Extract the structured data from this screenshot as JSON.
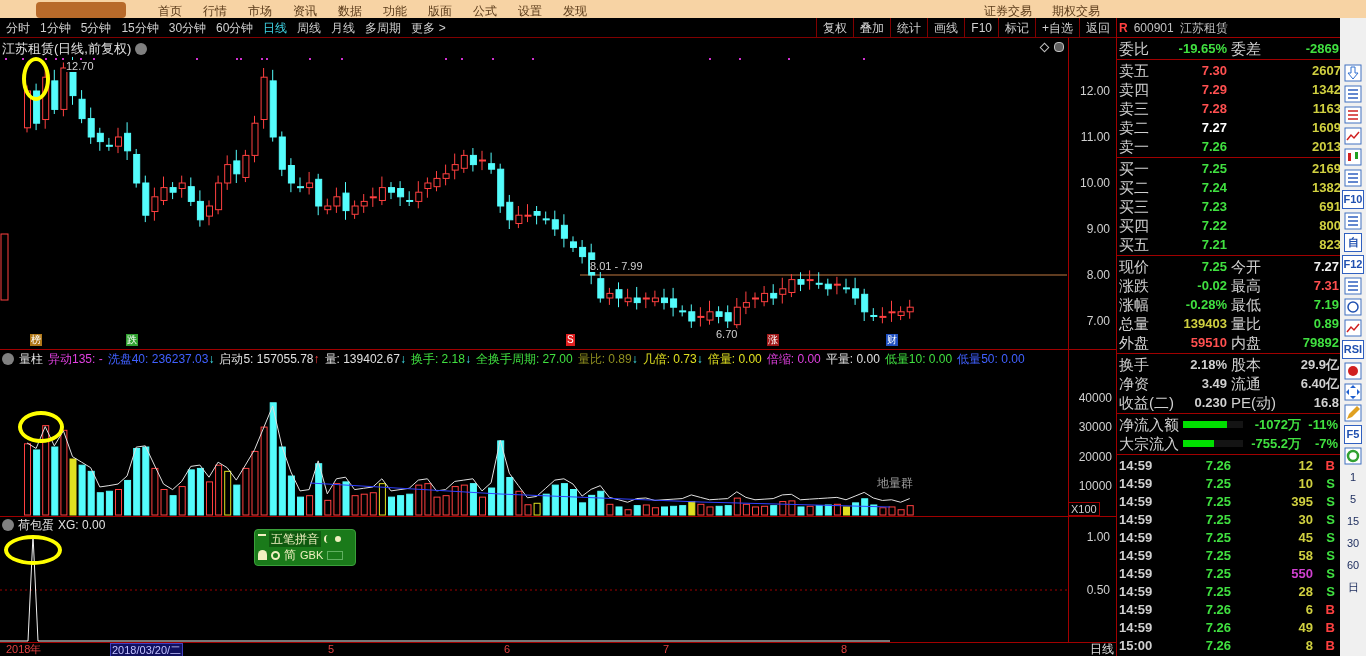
{
  "top_menu": {
    "items": [
      "首页",
      "行情",
      "市场",
      "资讯",
      "数据",
      "功能",
      "版面",
      "公式",
      "设置",
      "发现"
    ],
    "right_items": [
      "证券交易",
      "期权交易"
    ]
  },
  "period_tabs": [
    {
      "label": "分时",
      "selected": false
    },
    {
      "label": "1分钟",
      "selected": false
    },
    {
      "label": "5分钟",
      "selected": false
    },
    {
      "label": "15分钟",
      "selected": false
    },
    {
      "label": "30分钟",
      "selected": false
    },
    {
      "label": "60分钟",
      "selected": false
    },
    {
      "label": "日线",
      "selected": true
    },
    {
      "label": "周线",
      "selected": false
    },
    {
      "label": "月线",
      "selected": false
    },
    {
      "label": "多周期",
      "selected": false
    },
    {
      "label": "更多 >",
      "selected": false
    }
  ],
  "chart_buttons": [
    "复权",
    "叠加",
    "统计",
    "画线",
    "F10",
    "标记",
    "+自选",
    "返回"
  ],
  "price_panel": {
    "title": "江苏租赁(日线,前复权)",
    "y_ticks": [
      "12.00",
      "11.00",
      "10.00",
      "9.00",
      "8.00",
      "7.00"
    ],
    "annotations": [
      "12.70",
      "8.01 - 7.99",
      "6.70"
    ],
    "markers": [
      {
        "label": "榜",
        "color": "#b07818"
      },
      {
        "label": "跌",
        "color": "#30a030"
      },
      {
        "label": "S",
        "color": "#e02020"
      },
      {
        "label": "涨",
        "color": "#a01818"
      },
      {
        "label": "财",
        "color": "#2050c0"
      }
    ]
  },
  "volume_panel": {
    "name": "量柱",
    "indicators": [
      {
        "text": "异动135: -",
        "color": "#e040e0"
      },
      {
        "text": "洗盘40: 236237.03",
        "color": "#4060ff",
        "arrow": "↓",
        "rising": false
      },
      {
        "text": "启动5: 157055.78",
        "color": "#e0e0e0",
        "arrow": "↑",
        "rising": true
      },
      {
        "text": "量: 139402.67",
        "color": "#e0e0e0",
        "arrow": "↓",
        "rising": false
      },
      {
        "text": "换手: 2.18",
        "color": "#40e040",
        "arrow": "↓",
        "rising": false
      },
      {
        "text": "全换手周期: 27.00",
        "color": "#40e040"
      },
      {
        "text": "量比: 0.89",
        "color": "#909020",
        "arrow": "↓",
        "rising": false
      },
      {
        "text": "几倍: 0.73",
        "color": "#e0e020",
        "arrow": "↓",
        "rising": false
      },
      {
        "text": "倍量: 0.00",
        "color": "#e0e020"
      },
      {
        "text": "倍缩: 0.00",
        "color": "#e040e0"
      },
      {
        "text": "平量: 0.00",
        "color": "#e0e0e0"
      },
      {
        "text": "低量10: 0.00",
        "color": "#40e040"
      },
      {
        "text": "低量50: 0.00",
        "color": "#4060ff"
      }
    ],
    "y_ticks": [
      "40000",
      "30000",
      "20000",
      "10000"
    ],
    "unit": "X100",
    "note": "地量群"
  },
  "signal_panel": {
    "name": "荷包蛋",
    "indicator": "XG: 0.00",
    "y_ticks": [
      "1.00",
      "0.50"
    ]
  },
  "ime_toolbar": {
    "mode": "五笔拼音",
    "charset": "简",
    "encoding": "GBK"
  },
  "date_axis": {
    "labels": [
      {
        "label": "2018年",
        "selected": false
      },
      {
        "label": "2018/03/20/二",
        "selected": true
      },
      {
        "label": "5",
        "selected": false
      },
      {
        "label": "6",
        "selected": false
      },
      {
        "label": "7",
        "selected": false
      },
      {
        "label": "8",
        "selected": false
      }
    ],
    "period": "日线"
  },
  "quote_panel": {
    "flag": "R",
    "code": "600901",
    "name": "江苏租赁",
    "ratio": {
      "label": "委比",
      "value": "-19.65%",
      "label2": "委差",
      "value2": "-2869"
    },
    "asks": [
      {
        "label": "卖五",
        "price": "7.30",
        "volume": "2607",
        "color": "#ff5050"
      },
      {
        "label": "卖四",
        "price": "7.29",
        "volume": "1342",
        "color": "#ff5050"
      },
      {
        "label": "卖三",
        "price": "7.28",
        "volume": "1163",
        "color": "#ff5050"
      },
      {
        "label": "卖二",
        "price": "7.27",
        "volume": "1609",
        "color": "#ffffff"
      },
      {
        "label": "卖一",
        "price": "7.26",
        "volume": "2013",
        "color": "#40e040"
      }
    ],
    "bids": [
      {
        "label": "买一",
        "price": "7.25",
        "volume": "2169",
        "color": "#40e040"
      },
      {
        "label": "买二",
        "price": "7.24",
        "volume": "1382",
        "color": "#40e040"
      },
      {
        "label": "买三",
        "price": "7.23",
        "volume": "691",
        "color": "#40e040"
      },
      {
        "label": "买四",
        "price": "7.22",
        "volume": "800",
        "color": "#40e040"
      },
      {
        "label": "买五",
        "price": "7.21",
        "volume": "823",
        "color": "#40e040"
      }
    ],
    "quote": [
      [
        {
          "label": "现价",
          "value": "7.25",
          "color": "#40e040"
        },
        {
          "label": "今开",
          "value": "7.27",
          "color": "#f0f0f0"
        }
      ],
      [
        {
          "label": "涨跌",
          "value": "-0.02",
          "color": "#40e040"
        },
        {
          "label": "最高",
          "value": "7.31",
          "color": "#ff5050"
        }
      ],
      [
        {
          "label": "涨幅",
          "value": "-0.28%",
          "color": "#40e040"
        },
        {
          "label": "最低",
          "value": "7.19",
          "color": "#40e040"
        }
      ],
      [
        {
          "label": "总量",
          "value": "139403",
          "color": "#d0d040"
        },
        {
          "label": "量比",
          "value": "0.89",
          "color": "#40e040"
        }
      ],
      [
        {
          "label": "外盘",
          "value": "59510",
          "color": "#ff5050"
        },
        {
          "label": "内盘",
          "value": "79892",
          "color": "#40e040"
        }
      ]
    ],
    "stats": [
      {
        "label": "换手",
        "value": "2.18%",
        "label2": "股本",
        "value2": "29.9亿"
      },
      {
        "label": "净资",
        "value": "3.49",
        "label2": "流通",
        "value2": "6.40亿"
      },
      {
        "label": "收益(二)",
        "value": "0.230",
        "label2": "PE(动)",
        "value2": "16.8"
      }
    ],
    "flows": [
      {
        "label": "净流入额",
        "level": 0.73,
        "amount": "-1072万",
        "percent": "-11%"
      },
      {
        "label": "大宗流入",
        "level": 0.52,
        "amount": "-755.2万",
        "percent": "-7%"
      }
    ],
    "ticks": [
      {
        "time": "14:59",
        "price": "7.26",
        "volume": "12",
        "side": "B",
        "buy": true,
        "large": false
      },
      {
        "time": "14:59",
        "price": "7.25",
        "volume": "10",
        "side": "S",
        "buy": false,
        "large": false
      },
      {
        "time": "14:59",
        "price": "7.25",
        "volume": "395",
        "side": "S",
        "buy": false,
        "large": false
      },
      {
        "time": "14:59",
        "price": "7.25",
        "volume": "30",
        "side": "S",
        "buy": false,
        "large": false
      },
      {
        "time": "14:59",
        "price": "7.25",
        "volume": "45",
        "side": "S",
        "buy": false,
        "large": false
      },
      {
        "time": "14:59",
        "price": "7.25",
        "volume": "58",
        "side": "S",
        "buy": false,
        "large": false
      },
      {
        "time": "14:59",
        "price": "7.25",
        "volume": "550",
        "side": "S",
        "buy": false,
        "large": true
      },
      {
        "time": "14:59",
        "price": "7.25",
        "volume": "28",
        "side": "S",
        "buy": false,
        "large": false
      },
      {
        "time": "14:59",
        "price": "7.26",
        "volume": "6",
        "side": "B",
        "buy": true,
        "large": false
      },
      {
        "time": "14:59",
        "price": "7.26",
        "volume": "49",
        "side": "B",
        "buy": true,
        "large": false
      },
      {
        "time": "15:00",
        "price": "7.26",
        "volume": "8",
        "side": "B",
        "buy": true,
        "large": false
      }
    ]
  },
  "side_toolbar": [
    "F10",
    "自",
    "F12",
    "RSI",
    "F5",
    "1",
    "5",
    "15",
    "30",
    "60",
    "日"
  ]
}
